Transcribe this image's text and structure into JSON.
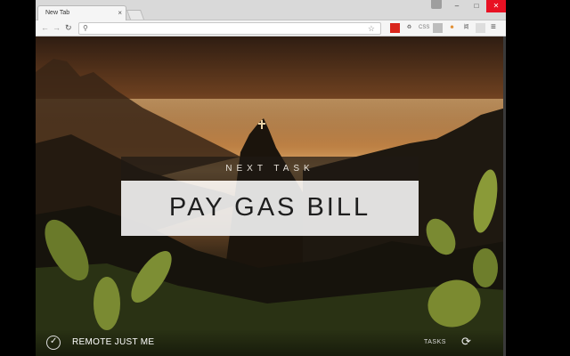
{
  "browser": {
    "tab_title": "New Tab",
    "tab_close_glyph": "×",
    "window_buttons": {
      "minimize": "–",
      "maximize": "□",
      "close": "✕"
    },
    "toolbar": {
      "back_glyph": "←",
      "forward_glyph": "→",
      "reload_glyph": "↻",
      "search_glyph": "⚲",
      "star_glyph": "☆",
      "menu_glyph": "≡",
      "extensions": [
        {
          "name": "ext-red-icon",
          "text": "",
          "color": "#d9261c"
        },
        {
          "name": "ext-recycle-icon",
          "text": "♻",
          "color": "#555555"
        },
        {
          "name": "ext-css-icon",
          "text": "CSS",
          "color": "#777777"
        },
        {
          "name": "ext-grid-icon",
          "text": "",
          "color": "#bdbdbd"
        },
        {
          "name": "ext-smiley-icon",
          "text": "☻",
          "color": "#e08a2a"
        },
        {
          "name": "ext-text-icon",
          "text": "阅",
          "color": "#555555"
        },
        {
          "name": "ext-blank-icon",
          "text": "",
          "color": "#dddddd"
        }
      ]
    }
  },
  "momentum": {
    "label": "NEXT TASK",
    "task": "PAY GAS BILL",
    "workspace": "REMOTE JUST ME",
    "tasks_link": "TASKS",
    "sync_glyph": "⟳",
    "logo_glyph": "✓"
  }
}
